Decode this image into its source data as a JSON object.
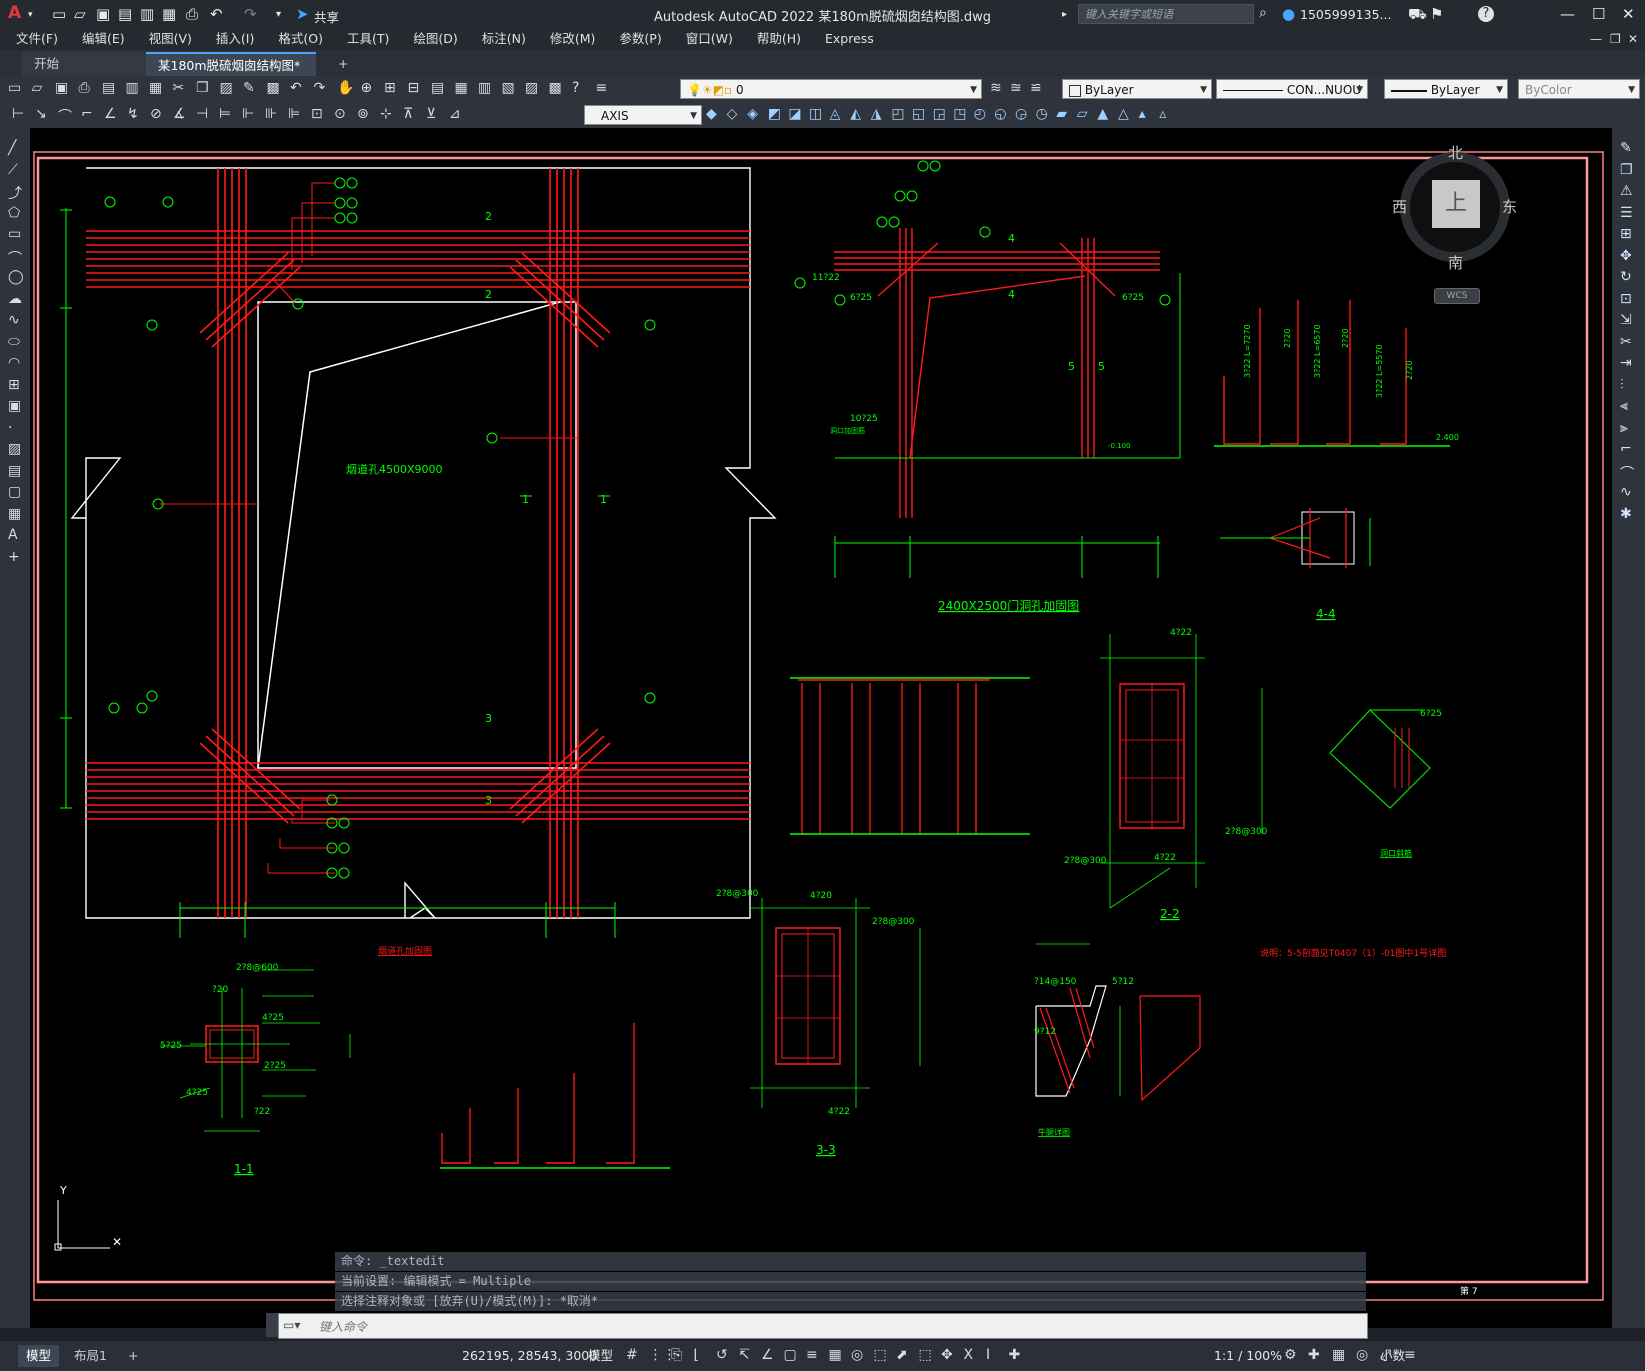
{
  "window": {
    "title": "Autodesk AutoCAD 2022    某180m脱硫烟囱结构图.dwg",
    "share": "共享",
    "search_placeholder": "键入关键字或短语",
    "user": "1505999135...",
    "help": "?"
  },
  "menu": [
    "文件(F)",
    "编辑(E)",
    "视图(V)",
    "插入(I)",
    "格式(O)",
    "工具(T)",
    "绘图(D)",
    "标注(N)",
    "修改(M)",
    "参数(P)",
    "窗口(W)",
    "帮助(H)",
    "Express"
  ],
  "tabs": {
    "start": "开始",
    "doc": "某180m脱硫烟囱结构图*",
    "new": "+"
  },
  "toolbar": {
    "layer_value": "0",
    "color": "ByLayer",
    "linetype": "CON...NUOU",
    "lineweight": "ByLayer",
    "plotstyle": "ByColor",
    "dimstyle": "AXIS"
  },
  "viewcube": {
    "north": "北",
    "south": "南",
    "west": "西",
    "east": "东",
    "top": "上",
    "wcs": "WCS"
  },
  "drawing": {
    "opening_label": "烟道孔4500X9000",
    "opening_title": "烟道孔加固图",
    "door_title": "2400X2500门洞孔加固图",
    "section_4": "4-4",
    "section_2": "2-2",
    "section_3": "3-3",
    "section_1": "1-1",
    "corner_title": "洞口斜筋",
    "bracket_title": "牛腿详图",
    "note": "说明：5-5剖面见T0407（1）-01图中1号详图",
    "sheet_no": "第 7"
  },
  "command": {
    "history": [
      "命令: _textedit",
      "当前设置: 编辑模式 = Multiple",
      "选择注释对象或 [放弃(U)/模式(M)]: *取消*"
    ],
    "placeholder": "键入命令"
  },
  "status": {
    "tab_model": "模型",
    "tab_layout": "布局1",
    "coords": "262195, 28543, 3000",
    "space": "模型",
    "scale": "1:1 / 100%",
    "units": "小数"
  },
  "colors": {
    "rebar": "#ff1a1a",
    "dim": "#00ff00",
    "outline": "#ffffff",
    "frame": "#ff8080"
  }
}
